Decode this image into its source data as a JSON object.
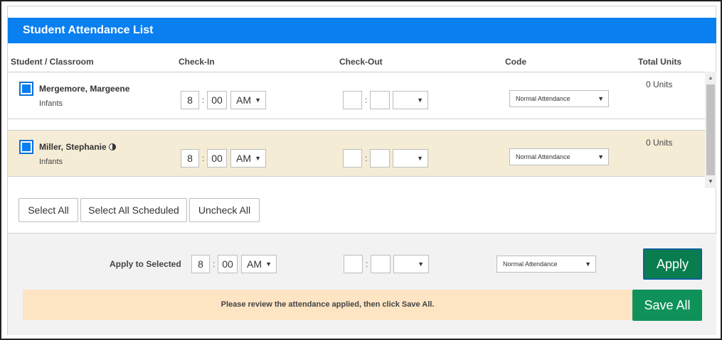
{
  "header": {
    "title": "Student Attendance List"
  },
  "columns": {
    "student": "Student / Classroom",
    "checkin": "Check-In",
    "checkout": "Check-Out",
    "code": "Code",
    "units": "Total Units"
  },
  "rows": [
    {
      "name": "Mergemore, Margeene",
      "classroom": "Infants",
      "checked": true,
      "checkin": {
        "hour": "8",
        "minute": "00",
        "ampm": "AM"
      },
      "checkout": {
        "hour": "",
        "minute": "",
        "ampm": ""
      },
      "code": "Normal Attendance",
      "units": "0 Units"
    },
    {
      "name": "Miller, Stephanie",
      "classroom": "Infants",
      "checked": true,
      "icon": "half-moon-icon",
      "checkin": {
        "hour": "8",
        "minute": "00",
        "ampm": "AM"
      },
      "checkout": {
        "hour": "",
        "minute": "",
        "ampm": ""
      },
      "code": "Normal Attendance",
      "units": "0 Units"
    }
  ],
  "buttons": {
    "select_all": "Select All",
    "select_all_scheduled": "Select All Scheduled",
    "uncheck_all": "Uncheck All"
  },
  "apply": {
    "label": "Apply to Selected",
    "checkin": {
      "hour": "8",
      "minute": "00",
      "ampm": "AM"
    },
    "checkout": {
      "hour": "",
      "minute": "",
      "ampm": ""
    },
    "code": "Normal Attendance",
    "apply_label": "Apply",
    "notice": "Please review the attendance applied, then click Save All.",
    "save_label": "Save All"
  },
  "colors": {
    "header": "#0a7ff0",
    "row_highlight": "#f5ecd6",
    "apply_button": "#0a7d4e",
    "save_button": "#0f915a",
    "notice_bg": "#fde4c3"
  }
}
